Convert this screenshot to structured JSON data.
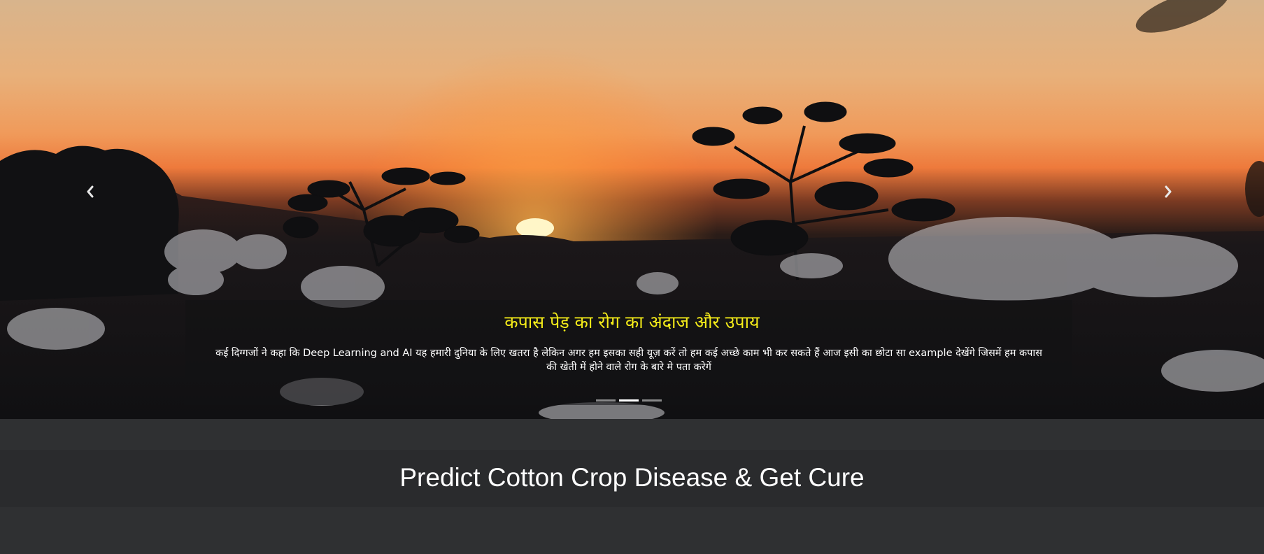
{
  "carousel": {
    "slide_image": "cotton-field-sunset-photo",
    "caption": {
      "title": "कपास पेड़ का रोग का अंदाज और उपाय",
      "text_line1": "कई दिग्गजों ने कहा कि Deep Learning and AI यह हमारी दुनिया के लिए खतरा है लेकिन अगर हम इसका सही यूज़ करें तो हम कई अच्छे काम भी कर सकते हैं आज इसी का छोटा सा example देखेंगे जिसमें हम कपास",
      "text_line2": "की खेती में होने वाले रोग के बारे मे पता करेगें"
    },
    "indicators": {
      "count": 3,
      "active_index": 1
    },
    "prev_icon": "chevron-left-icon",
    "next_icon": "chevron-right-icon"
  },
  "main": {
    "heading": "Predict Cotton Crop Disease & Get Cure"
  },
  "colors": {
    "caption_title": "#f5ec19",
    "page_background": "#2f3032",
    "heading_band": "#2a2b2d"
  }
}
